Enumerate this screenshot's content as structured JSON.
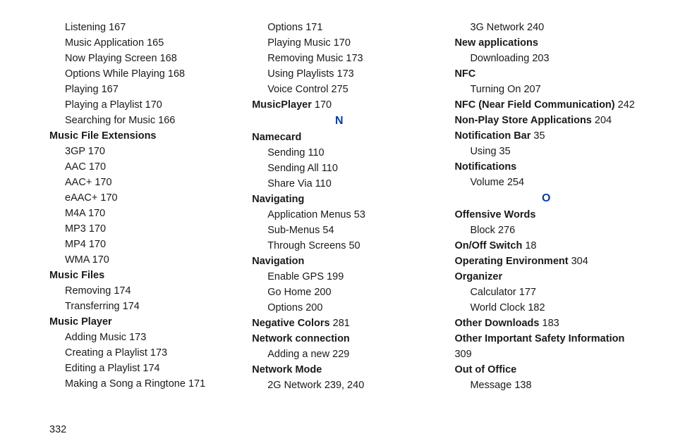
{
  "pageNumber": "332",
  "columns": [
    {
      "items": [
        {
          "type": "sub",
          "label": "Listening",
          "num": "167"
        },
        {
          "type": "sub",
          "label": "Music Application",
          "num": "165"
        },
        {
          "type": "sub",
          "label": "Now Playing Screen",
          "num": "168"
        },
        {
          "type": "sub",
          "label": "Options While Playing",
          "num": "168"
        },
        {
          "type": "sub",
          "label": "Playing",
          "num": "167"
        },
        {
          "type": "sub",
          "label": "Playing a Playlist",
          "num": "170"
        },
        {
          "type": "sub",
          "label": "Searching for Music",
          "num": "166"
        },
        {
          "type": "head",
          "label": "Music File Extensions"
        },
        {
          "type": "sub",
          "label": "3GP",
          "num": "170"
        },
        {
          "type": "sub",
          "label": "AAC",
          "num": "170"
        },
        {
          "type": "sub",
          "label": "AAC+",
          "num": "170"
        },
        {
          "type": "sub",
          "label": "eAAC+",
          "num": "170"
        },
        {
          "type": "sub",
          "label": "M4A",
          "num": "170"
        },
        {
          "type": "sub",
          "label": "MP3",
          "num": "170"
        },
        {
          "type": "sub",
          "label": "MP4",
          "num": "170"
        },
        {
          "type": "sub",
          "label": "WMA",
          "num": "170"
        },
        {
          "type": "head",
          "label": "Music Files"
        },
        {
          "type": "sub",
          "label": "Removing",
          "num": "174"
        },
        {
          "type": "sub",
          "label": "Transferring",
          "num": "174"
        },
        {
          "type": "head",
          "label": "Music Player"
        },
        {
          "type": "sub",
          "label": "Adding Music",
          "num": "173"
        },
        {
          "type": "sub",
          "label": "Creating a Playlist",
          "num": "173"
        },
        {
          "type": "sub",
          "label": "Editing a Playlist",
          "num": "174"
        },
        {
          "type": "sub",
          "label": "Making a Song a Ringtone",
          "num": "171"
        }
      ]
    },
    {
      "items": [
        {
          "type": "sub",
          "label": "Options",
          "num": "171"
        },
        {
          "type": "sub",
          "label": "Playing Music",
          "num": "170"
        },
        {
          "type": "sub",
          "label": "Removing Music",
          "num": "173"
        },
        {
          "type": "sub",
          "label": "Using Playlists",
          "num": "173"
        },
        {
          "type": "sub",
          "label": "Voice Control",
          "num": "275"
        },
        {
          "type": "headnum",
          "label": "MusicPlayer",
          "num": "170"
        },
        {
          "type": "letter",
          "label": "N"
        },
        {
          "type": "head",
          "label": "Namecard"
        },
        {
          "type": "sub",
          "label": "Sending",
          "num": "110"
        },
        {
          "type": "sub",
          "label": "Sending All",
          "num": "110"
        },
        {
          "type": "sub",
          "label": "Share Via",
          "num": "110"
        },
        {
          "type": "head",
          "label": "Navigating"
        },
        {
          "type": "sub",
          "label": "Application Menus",
          "num": "53"
        },
        {
          "type": "sub",
          "label": "Sub-Menus",
          "num": "54"
        },
        {
          "type": "sub",
          "label": "Through Screens",
          "num": "50"
        },
        {
          "type": "head",
          "label": "Navigation"
        },
        {
          "type": "sub",
          "label": "Enable GPS",
          "num": "199"
        },
        {
          "type": "sub",
          "label": "Go Home",
          "num": "200"
        },
        {
          "type": "sub",
          "label": "Options",
          "num": "200"
        },
        {
          "type": "headnum",
          "label": "Negative Colors",
          "num": "281"
        },
        {
          "type": "head",
          "label": "Network connection"
        },
        {
          "type": "sub",
          "label": "Adding a new",
          "num": "229"
        },
        {
          "type": "head",
          "label": "Network Mode"
        },
        {
          "type": "sub",
          "label": "2G Network",
          "num": "239, 240"
        }
      ]
    },
    {
      "items": [
        {
          "type": "sub",
          "label": "3G Network",
          "num": "240"
        },
        {
          "type": "head",
          "label": "New applications"
        },
        {
          "type": "sub",
          "label": "Downloading",
          "num": "203"
        },
        {
          "type": "head",
          "label": "NFC"
        },
        {
          "type": "sub",
          "label": "Turning On",
          "num": "207"
        },
        {
          "type": "headnum",
          "label": "NFC (Near Field Communication)",
          "num": "242"
        },
        {
          "type": "headnum",
          "label": "Non-Play Store Applications",
          "num": "204"
        },
        {
          "type": "headnum",
          "label": "Notification Bar",
          "num": "35"
        },
        {
          "type": "sub",
          "label": "Using",
          "num": "35"
        },
        {
          "type": "head",
          "label": "Notifications"
        },
        {
          "type": "sub",
          "label": "Volume",
          "num": "254"
        },
        {
          "type": "letter",
          "label": "O"
        },
        {
          "type": "head",
          "label": "Offensive Words"
        },
        {
          "type": "sub",
          "label": "Block",
          "num": "276"
        },
        {
          "type": "headnum",
          "label": "On/Off Switch",
          "num": "18"
        },
        {
          "type": "headnum",
          "label": "Operating Environment",
          "num": "304"
        },
        {
          "type": "head",
          "label": "Organizer"
        },
        {
          "type": "sub",
          "label": "Calculator",
          "num": "177"
        },
        {
          "type": "sub",
          "label": "World Clock",
          "num": "182"
        },
        {
          "type": "headnum",
          "label": "Other Downloads",
          "num": "183"
        },
        {
          "type": "headnum",
          "label": "Other Important Safety Information",
          "num": "309"
        },
        {
          "type": "head",
          "label": "Out of Office"
        },
        {
          "type": "sub",
          "label": "Message",
          "num": "138"
        }
      ]
    }
  ]
}
